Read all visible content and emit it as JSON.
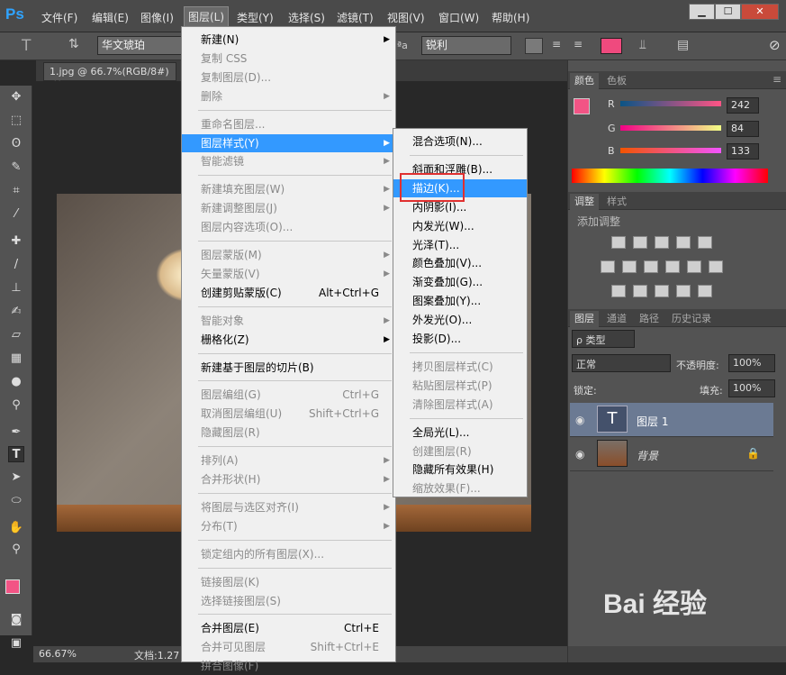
{
  "menubar": {
    "logo": "Ps",
    "items": [
      "文件(F)",
      "编辑(E)",
      "图像(I)",
      "图层(L)",
      "类型(Y)",
      "选择(S)",
      "滤镜(T)",
      "视图(V)",
      "窗口(W)",
      "帮助(H)"
    ],
    "win_min": "▁",
    "win_max": "☐",
    "win_close": "✕"
  },
  "options": {
    "tool_glyph": "T",
    "font_family": "华文琥珀",
    "aa_label": "ªa",
    "aa_value": "锐利",
    "text_color": "#ef4a7e"
  },
  "document": {
    "tab": "1.jpg @ 66.7%(RGB/8#)",
    "tab_close": "×",
    "zoom": "66.67%",
    "status": "文档:1.27"
  },
  "layer_menu": {
    "items": [
      {
        "label": "新建(N)",
        "sub": true
      },
      {
        "label": "复制 CSS",
        "dis": true
      },
      {
        "label": "复制图层(D)...",
        "dis": true
      },
      {
        "label": "删除",
        "dis": true,
        "sub": true
      },
      {
        "label": "重命名图层...",
        "dis": true
      },
      {
        "label": "图层样式(Y)",
        "hl": true,
        "sub": true
      },
      {
        "label": "智能滤镜",
        "dis": true,
        "sub": true
      },
      {
        "label": "新建填充图层(W)",
        "dis": true,
        "sub": true
      },
      {
        "label": "新建调整图层(J)",
        "dis": true,
        "sub": true
      },
      {
        "label": "图层内容选项(O)...",
        "dis": true
      },
      {
        "label": "图层蒙版(M)",
        "dis": true,
        "sub": true
      },
      {
        "label": "矢量蒙版(V)",
        "dis": true,
        "sub": true
      },
      {
        "label": "创建剪贴蒙版(C)",
        "sc": "Alt+Ctrl+G"
      },
      {
        "label": "智能对象",
        "dis": true,
        "sub": true
      },
      {
        "label": "栅格化(Z)",
        "sub": true
      },
      {
        "label": "新建基于图层的切片(B)"
      },
      {
        "label": "图层编组(G)",
        "dis": true,
        "sc": "Ctrl+G"
      },
      {
        "label": "取消图层编组(U)",
        "dis": true,
        "sc": "Shift+Ctrl+G"
      },
      {
        "label": "隐藏图层(R)",
        "dis": true
      },
      {
        "label": "排列(A)",
        "dis": true,
        "sub": true
      },
      {
        "label": "合并形状(H)",
        "dis": true,
        "sub": true
      },
      {
        "label": "将图层与选区对齐(I)",
        "dis": true,
        "sub": true
      },
      {
        "label": "分布(T)",
        "dis": true,
        "sub": true
      },
      {
        "label": "锁定组内的所有图层(X)...",
        "dis": true
      },
      {
        "label": "链接图层(K)",
        "dis": true
      },
      {
        "label": "选择链接图层(S)",
        "dis": true
      },
      {
        "label": "合并图层(E)",
        "sc": "Ctrl+E"
      },
      {
        "label": "合并可见图层",
        "dis": true,
        "sc": "Shift+Ctrl+E"
      },
      {
        "label": "拼合图像(F)",
        "dis": true
      }
    ]
  },
  "style_menu": {
    "items": [
      {
        "label": "混合选项(N)..."
      },
      {
        "label": "斜面和浮雕(B)..."
      },
      {
        "label": "描边(K)...",
        "hl": true
      },
      {
        "label": "内阴影(I)..."
      },
      {
        "label": "内发光(W)..."
      },
      {
        "label": "光泽(T)..."
      },
      {
        "label": "颜色叠加(V)..."
      },
      {
        "label": "渐变叠加(G)..."
      },
      {
        "label": "图案叠加(Y)..."
      },
      {
        "label": "外发光(O)..."
      },
      {
        "label": "投影(D)..."
      },
      {
        "label": "拷贝图层样式(C)",
        "dis": true
      },
      {
        "label": "粘贴图层样式(P)",
        "dis": true
      },
      {
        "label": "清除图层样式(A)",
        "dis": true
      },
      {
        "label": "全局光(L)..."
      },
      {
        "label": "创建图层(R)",
        "dis": true
      },
      {
        "label": "隐藏所有效果(H)"
      },
      {
        "label": "缩放效果(F)...",
        "dis": true
      }
    ]
  },
  "color_panel": {
    "tabs": [
      "颜色",
      "色板"
    ],
    "r_label": "R",
    "g_label": "G",
    "b_label": "B",
    "r": "242",
    "g": "84",
    "b": "133",
    "fg": "#f25485"
  },
  "adjust_panel": {
    "tabs": [
      "调整",
      "样式"
    ],
    "title": "添加调整"
  },
  "layers_panel": {
    "tabs": [
      "图层",
      "通道",
      "路径",
      "历史记录"
    ],
    "filter": "ρ 类型",
    "blend": "正常",
    "opacity_label": "不透明度:",
    "opacity": "100%",
    "lock_label": "锁定:",
    "fill_label": "填充:",
    "fill": "100%",
    "layers": [
      {
        "name": "图层 1",
        "thumb": "T",
        "active": true
      },
      {
        "name": "背景",
        "italic": true,
        "locked": true
      }
    ]
  },
  "watermark": "Bai 经验"
}
